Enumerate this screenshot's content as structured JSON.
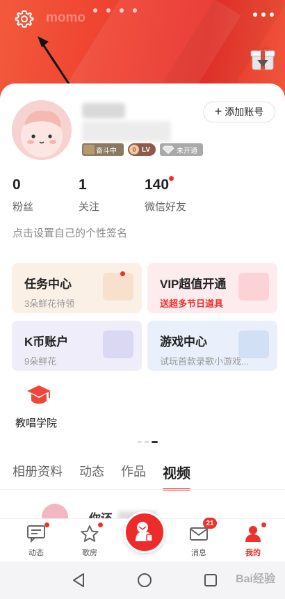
{
  "header": {
    "title": "momo",
    "pager_dots": 4
  },
  "profile": {
    "add_account_label": "添加账号",
    "add_account_icon": "plus-icon",
    "badges": {
      "level": "奋斗中",
      "lv_num": "0",
      "lv_label": "LV",
      "vip": "未开通"
    },
    "signature": "点击设置自己的个性签名"
  },
  "stats": [
    {
      "value": "0",
      "label": "粉丝",
      "dot": false
    },
    {
      "value": "1",
      "label": "关注",
      "dot": false
    },
    {
      "value": "140",
      "label": "微信好友",
      "dot": true
    }
  ],
  "tiles": {
    "task": {
      "title": "任务中心",
      "subtitle": "3朵鲜花待领"
    },
    "vip": {
      "title": "VIP超值开通",
      "subtitle": "送超多节日道具"
    },
    "kb": {
      "title": "K币账户",
      "subtitle": "9朵鲜花"
    },
    "game": {
      "title": "游戏中心",
      "subtitle": "试玩首款录歌小游戏..."
    }
  },
  "academy": {
    "label": "教唱学院"
  },
  "tabs": [
    "相册资料",
    "动态",
    "作品",
    "视频"
  ],
  "active_tab": 3,
  "partial_row": {
    "text": "你还"
  },
  "bottom_nav": {
    "items": [
      {
        "label": "动态",
        "icon": "chat-icon"
      },
      {
        "label": "歌房",
        "icon": "star-icon"
      },
      {
        "label": "消息",
        "icon": "mail-icon",
        "count": "21"
      },
      {
        "label": "我的",
        "icon": "person-icon"
      }
    ]
  },
  "watermark": "Bai经验",
  "colors": {
    "accent": "#f0302a",
    "header_start": "#f25a3c",
    "header_end": "#e8302a"
  }
}
